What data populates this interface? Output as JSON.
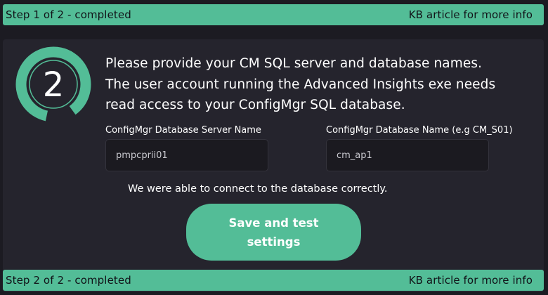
{
  "top_bar": {
    "status": "Step 1 of 2 - completed",
    "kb_link": "KB article for more info"
  },
  "step_indicator": {
    "number": "2",
    "icon": "step-progress-ring-icon"
  },
  "instructions": {
    "line1": "Please provide your CM SQL server and database names.",
    "line2": "The user account running the Advanced Insights exe needs",
    "line3": "read access to your ConfigMgr SQL database."
  },
  "form": {
    "server": {
      "label": "ConfigMgr Database Server Name",
      "value": "pmpcprii01"
    },
    "database": {
      "label": "ConfigMgr Database Name (e.g CM_S01)",
      "value": "cm_ap1"
    }
  },
  "status_message": "We were able to connect to the database correctly.",
  "save_button": {
    "label": "Save and test settings"
  },
  "bottom_bar": {
    "status": "Step 2 of 2 - completed",
    "kb_link": "KB article for more info"
  },
  "colors": {
    "accent": "#53bd97",
    "background": "#1c1b22",
    "panel": "#25242d",
    "input_background": "#1b1a20"
  }
}
